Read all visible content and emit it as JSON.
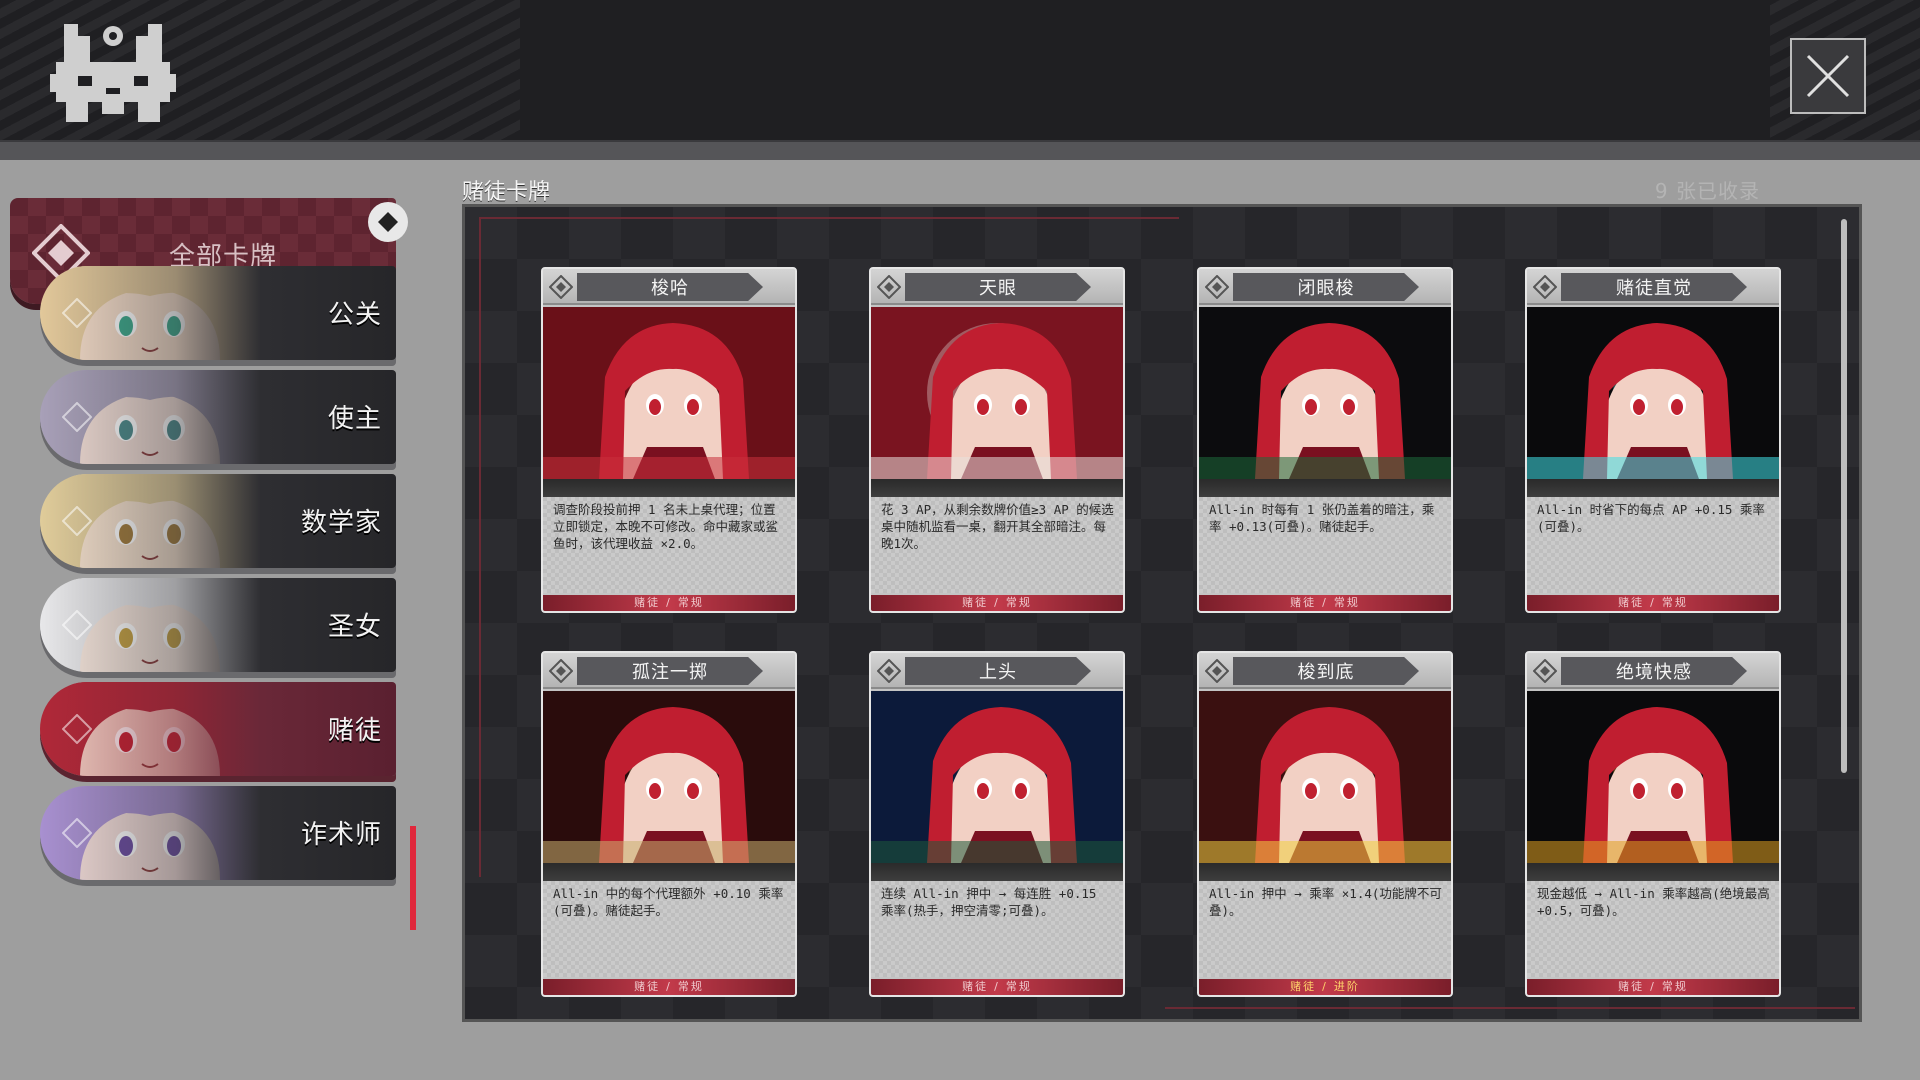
{
  "panel": {
    "title": "赌徒卡牌",
    "count": "9 张已收录"
  },
  "sidebar": {
    "all_label": "全部卡牌",
    "items": [
      {
        "name": "公关",
        "hair": "#e2c89a",
        "skin": "#f4dcc8",
        "eye": "#3aa88a"
      },
      {
        "name": "使主",
        "hair": "#a8a0b8",
        "skin": "#f0dcd4",
        "eye": "#4a8a8a"
      },
      {
        "name": "数学家",
        "hair": "#e0cc9a",
        "skin": "#f4e0cc",
        "eye": "#a07a3a"
      },
      {
        "name": "圣女",
        "hair": "#e8e8ea",
        "skin": "#f6e6dc",
        "eye": "#c4a040"
      },
      {
        "name": "赌徒",
        "hair": "#b02838",
        "skin": "#f2d0c4",
        "eye": "#c02030"
      },
      {
        "name": "诈术师",
        "hair": "#a890d0",
        "skin": "#f2dcd8",
        "eye": "#6a4aa0"
      }
    ]
  },
  "cards": [
    {
      "title": "梭哈",
      "desc": "调查阶段投前押 1 名未上桌代理；位置立即锁定，本晚不可修改。命中藏家或鲨鱼时，该代理收益 ×2.0。",
      "tag1": "赌徒",
      "tag2": "常规",
      "advanced": false,
      "bg": "#6a1018",
      "accent": "#c8303c"
    },
    {
      "title": "天眼",
      "desc": "花 3 AP，从剩余数牌价值≥3 AP 的候选桌中随机监看一桌，翻开其全部暗注。每晚1次。",
      "tag1": "赌徒",
      "tag2": "常规",
      "advanced": false,
      "bg": "#7a1420",
      "accent": "#e8e0dc"
    },
    {
      "title": "闭眼梭",
      "desc": "All-in 时每有 1 张仍盖着的暗注，乘率 +0.13(可叠)。赌徒起手。",
      "tag1": "赌徒",
      "tag2": "常规",
      "advanced": false,
      "bg": "#0c0c0e",
      "accent": "#1e6a3a"
    },
    {
      "title": "赌徒直觉",
      "desc": "All-in 时省下的每点 AP +0.15 乘率(可叠)。",
      "tag1": "赌徒",
      "tag2": "常规",
      "advanced": false,
      "bg": "#0a0a0c",
      "accent": "#40e0e8"
    },
    {
      "title": "孤注一掷",
      "desc": "All-in 中的每个代理额外 +0.10 乘率(可叠)。赌徒起手。",
      "tag1": "赌徒",
      "tag2": "常规",
      "advanced": false,
      "bg": "#2a0c0c",
      "accent": "#c8b070"
    },
    {
      "title": "上头",
      "desc": "连续 All-in 押中 → 每连胜 +0.15 乘率(热手，押空清零;可叠)。",
      "tag1": "赌徒",
      "tag2": "常规",
      "advanced": false,
      "bg": "#0c1a3a",
      "accent": "#1e5a3a"
    },
    {
      "title": "梭到底",
      "desc": "All-in 押中 → 乘率 ×1.4(功能牌不可叠)。",
      "tag1": "赌徒",
      "tag2": "进阶",
      "advanced": true,
      "bg": "#3a1010",
      "accent": "#f0d040"
    },
    {
      "title": "绝境快感",
      "desc": "现金越低 → All-in 乘率越高(绝境最高 +0.5，可叠)。",
      "tag1": "赌徒",
      "tag2": "常规",
      "advanced": false,
      "bg": "#0a0a0c",
      "accent": "#e0a020"
    }
  ],
  "colors": {
    "accent": "#e0283c",
    "panel_bg": "#26262a",
    "card_footer": "#c23a4a"
  },
  "icons": {
    "close": "close-icon",
    "logo": "rabbit-logo-icon",
    "diamond": "diamond-icon"
  }
}
